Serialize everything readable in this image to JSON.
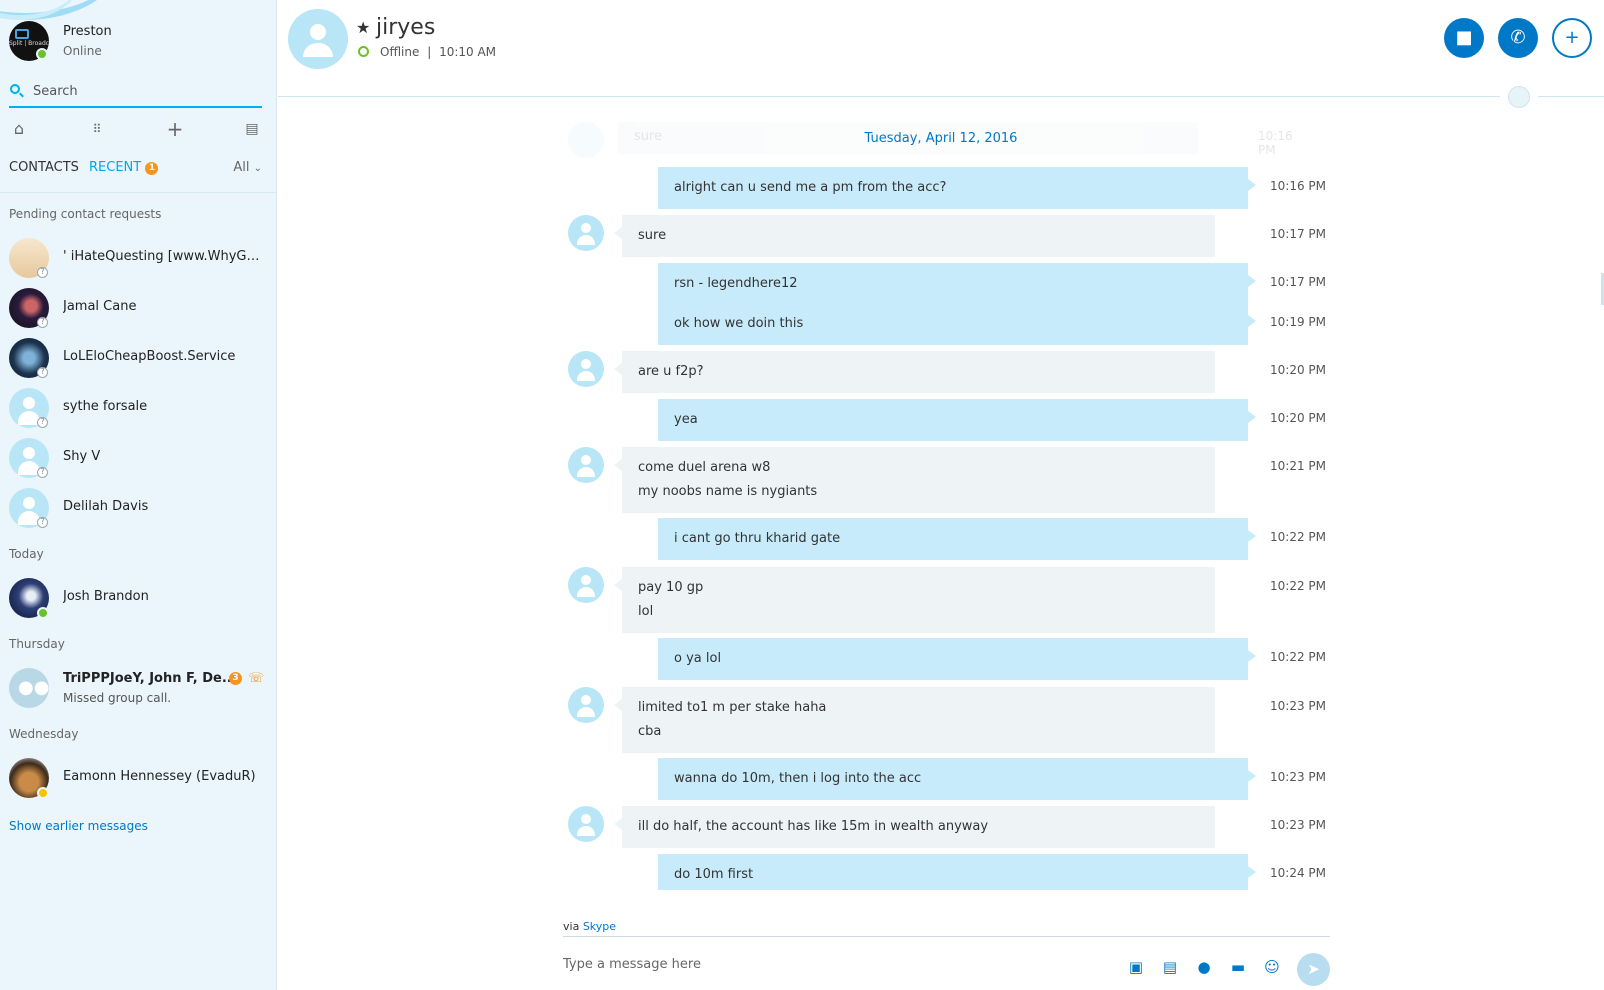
{
  "me": {
    "name": "Preston",
    "status": "Online",
    "avatar_text": "Split | Broadcast"
  },
  "search": {
    "placeholder": "Search"
  },
  "toolbar": {
    "icons": [
      "home-icon",
      "dialpad-icon",
      "add-icon",
      "contact-card-icon"
    ]
  },
  "tabs": {
    "contacts": "CONTACTS",
    "recent": "RECENT",
    "recent_badge": "1",
    "filter": "All"
  },
  "sections": {
    "pending": "Pending contact requests",
    "today": "Today",
    "thursday": "Thursday",
    "wednesday": "Wednesday"
  },
  "contacts": [
    {
      "name": "'   iHateQuesting [www.WhyGrin...",
      "presence": "unknown"
    },
    {
      "name": "Jamal Cane",
      "presence": "unknown"
    },
    {
      "name": "LoLEloCheapBoost.Service",
      "presence": "unknown"
    },
    {
      "name": "sythe forsale",
      "presence": "unknown"
    },
    {
      "name": "Shy V",
      "presence": "unknown"
    },
    {
      "name": "Delilah Davis",
      "presence": "unknown"
    },
    {
      "name": "Josh Brandon",
      "presence": "online"
    },
    {
      "name": "TriPPPJoeY, John F, De...",
      "sub": "Missed group call.",
      "badge": "3"
    },
    {
      "name": "Eamonn Hennessey (EvaduR)",
      "presence": "away"
    }
  ],
  "show_earlier": "Show earlier messages",
  "chat": {
    "name": "jiryes",
    "status": "Offline",
    "time": "10:10 AM",
    "separator": "|"
  },
  "date_separator": "Tuesday, April 12, 2016",
  "ghost": {
    "text": "sure",
    "time": "10:16 PM"
  },
  "messages": [
    {
      "dir": "out",
      "lines": [
        "alright can u send me a pm from the acc?"
      ],
      "time": "10:16 PM"
    },
    {
      "dir": "in",
      "lines": [
        "sure"
      ],
      "time": "10:17 PM"
    },
    {
      "dir": "out",
      "lines": [
        "rsn - legendhere12"
      ],
      "time": "10:17 PM"
    },
    {
      "dir": "out",
      "lines": [
        "ok how we doin this"
      ],
      "time": "10:19 PM"
    },
    {
      "dir": "in",
      "lines": [
        "are u f2p?"
      ],
      "time": "10:20 PM"
    },
    {
      "dir": "out",
      "lines": [
        "yea"
      ],
      "time": "10:20 PM"
    },
    {
      "dir": "in",
      "lines": [
        "come duel arena w8",
        "my noobs name is nygiants"
      ],
      "time": "10:21 PM"
    },
    {
      "dir": "out",
      "lines": [
        "i cant go thru kharid gate"
      ],
      "time": "10:22 PM"
    },
    {
      "dir": "in",
      "lines": [
        "pay 10 gp",
        "lol"
      ],
      "time": "10:22 PM"
    },
    {
      "dir": "out",
      "lines": [
        "o ya lol"
      ],
      "time": "10:22 PM"
    },
    {
      "dir": "in",
      "lines": [
        "limited to1 m per stake haha",
        "cba"
      ],
      "time": "10:23 PM"
    },
    {
      "dir": "out",
      "lines": [
        "wanna do 10m, then i log into the acc"
      ],
      "time": "10:23 PM"
    },
    {
      "dir": "in",
      "lines": [
        "ill do half, the account has like 15m in wealth anyway"
      ],
      "time": "10:23 PM"
    },
    {
      "dir": "out",
      "lines": [
        "do 10m first"
      ],
      "time": "10:24 PM"
    }
  ],
  "composer": {
    "via_prefix": "via",
    "via_link": "Skype",
    "placeholder": "Type a message here",
    "icons": [
      "media-gallery-icon",
      "file-icon",
      "video-message-icon",
      "contact-share-icon",
      "emoticon-icon",
      "send-icon"
    ]
  },
  "colors": {
    "accent": "#0078c8",
    "outgoing_bubble": "#c7ebfa",
    "incoming_bubble": "#eef3f6",
    "badge": "#f7941d",
    "online": "#6ac22a"
  }
}
